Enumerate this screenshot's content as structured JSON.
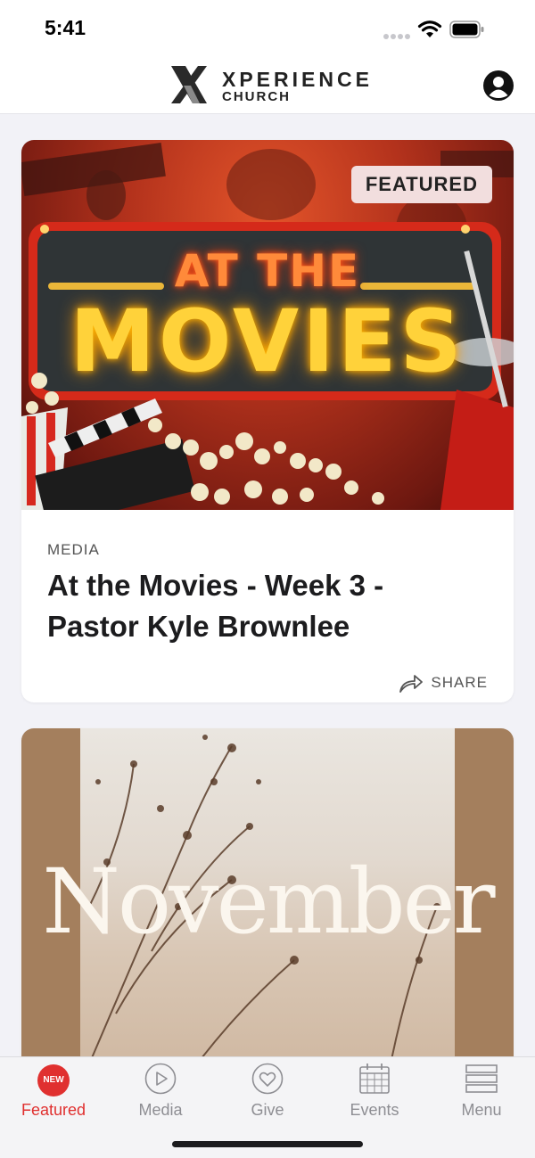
{
  "status_bar": {
    "time": "5:41"
  },
  "header": {
    "logo_word": "XPERIENCE",
    "logo_sub": "CHURCH",
    "profile_icon": "user-circle-icon"
  },
  "cards": [
    {
      "badge": "FEATURED",
      "hero_line1": "AT THE",
      "hero_line2": "MOVIES",
      "category": "MEDIA",
      "title": "At the Movies - Week 3 - Pastor Kyle Brownlee",
      "share_label": "SHARE"
    },
    {
      "hero_word": "November"
    }
  ],
  "tabs": [
    {
      "label": "Featured",
      "badge": "NEW",
      "icon": "new-badge-icon",
      "active": true
    },
    {
      "label": "Media",
      "icon": "play-circle-icon",
      "active": false
    },
    {
      "label": "Give",
      "icon": "heart-circle-icon",
      "active": false
    },
    {
      "label": "Events",
      "icon": "calendar-icon",
      "active": false
    },
    {
      "label": "Menu",
      "icon": "menu-lines-icon",
      "active": false
    }
  ],
  "colors": {
    "accent": "#e0302f",
    "tab_inactive": "#8e8e93",
    "background": "#f2f2f7",
    "november_frame": "#a47f5d"
  }
}
